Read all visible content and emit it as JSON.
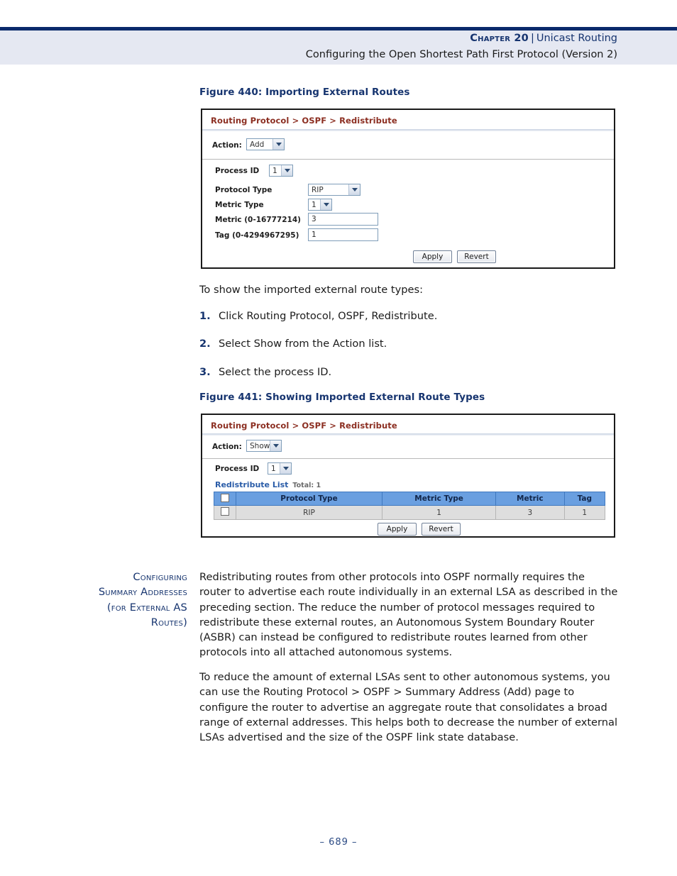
{
  "header": {
    "chapter": "Chapter 20",
    "separator": "|",
    "chapter_subject": "Unicast Routing",
    "subtitle": "Configuring the Open Shortest Path First Protocol (Version 2)",
    "rule_color": "#0a2a6b",
    "band_color": "#e5e8f2"
  },
  "figure440": {
    "caption": "Figure 440:  Importing External Routes",
    "panel_title": "Routing Protocol > OSPF > Redistribute",
    "action_label": "Action:",
    "action_value": "Add",
    "fields": [
      {
        "label": "Process ID",
        "value": "1",
        "kind": "select"
      },
      {
        "label": "Protocol Type",
        "value": "RIP",
        "kind": "select"
      },
      {
        "label": "Metric Type",
        "value": "1",
        "kind": "select"
      },
      {
        "label": "Metric (0-16777214)",
        "value": "3",
        "kind": "text"
      },
      {
        "label": "Tag (0-4294967295)",
        "value": "1",
        "kind": "text"
      }
    ],
    "apply_label": "Apply",
    "revert_label": "Revert"
  },
  "intro": {
    "lead": "To show the imported external route types:",
    "steps": [
      {
        "num": "1.",
        "text": "Click Routing Protocol, OSPF, Redistribute."
      },
      {
        "num": "2.",
        "text": "Select Show from the Action list."
      },
      {
        "num": "3.",
        "text": "Select the process ID."
      }
    ]
  },
  "figure441": {
    "caption": "Figure 441:  Showing Imported External Route Types",
    "panel_title": "Routing Protocol > OSPF > Redistribute",
    "action_label": "Action:",
    "action_value": "Show",
    "process_label": "Process ID",
    "process_value": "1",
    "list_title": "Redistribute List",
    "list_total": "Total: 1",
    "table": {
      "columns": [
        "",
        "Protocol Type",
        "Metric Type",
        "Metric",
        "Tag"
      ],
      "rows": [
        {
          "checked": false,
          "protocol_type": "RIP",
          "metric_type": "1",
          "metric": "3",
          "tag": "1"
        }
      ]
    },
    "apply_label": "Apply",
    "revert_label": "Revert"
  },
  "section": {
    "heading_lines": [
      "Configuring",
      "Summary Addresses",
      "(for External AS",
      "Routes)"
    ],
    "paragraphs": [
      "Redistributing routes from other protocols into OSPF normally requires the router to advertise each route individually in an external LSA as described in the preceding section. The reduce the number of protocol messages required to redistribute these external routes, an Autonomous System Boundary Router (ASBR) can instead be configured to redistribute routes learned from other protocols into all attached autonomous systems.",
      "To reduce the amount of external LSAs sent to other autonomous systems, you can use the Routing Protocol > OSPF > Summary Address (Add) page to configure the router to advertise an aggregate route that consolidates a broad range of external addresses. This helps both to decrease the number of external LSAs advertised and the size of the OSPF link state database."
    ]
  },
  "footer": {
    "page_number": "–  689  –"
  }
}
